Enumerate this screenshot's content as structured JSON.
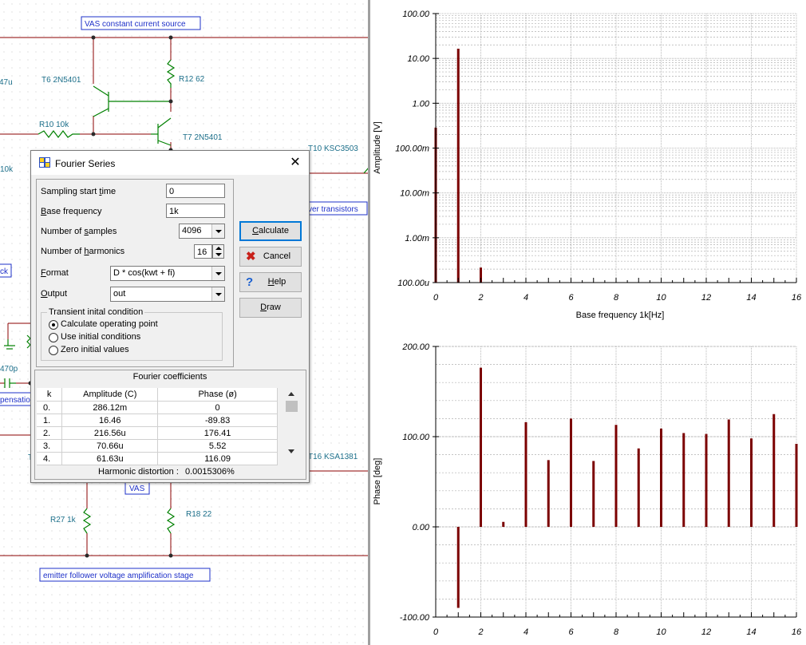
{
  "schematic": {
    "labels_boxed": [
      "VAS constant current source",
      "ver transistors",
      "ck",
      "pensatio",
      "VAS",
      "emitter follower voltage amplification stage"
    ],
    "labels": [
      "T6 2N5401",
      "R12 62",
      "R10 10k",
      "T7 2N5401",
      "T10 KSC3503",
      "47u",
      "10k",
      "470p",
      "T16 KSA1381",
      "R27 1k",
      "R18 22",
      "T"
    ]
  },
  "dialog": {
    "title": "Fourier Series",
    "close": "✕",
    "sampling_start_time": {
      "pre": "Sampling start ",
      "key": "t",
      "post": "ime",
      "value": "0"
    },
    "base_frequency": {
      "pre": "",
      "key": "B",
      "post": "ase frequency",
      "value": "1k"
    },
    "number_of_samples": {
      "pre": "Number of ",
      "key": "s",
      "post": "amples",
      "value": "4096"
    },
    "number_of_harmonics": {
      "pre": "Number of ",
      "key": "h",
      "post": "armonics",
      "value": "16"
    },
    "format": {
      "pre": "",
      "key": "F",
      "post": "ormat",
      "value": "D * cos(kwt + fi)"
    },
    "output": {
      "pre": "",
      "key": "O",
      "post": "utput",
      "value": "out"
    },
    "buttons": {
      "calculate": {
        "pre": "",
        "key": "C",
        "post": "alculate"
      },
      "cancel": "Cancel",
      "help": {
        "pre": "",
        "key": "H",
        "post": "elp"
      },
      "draw": {
        "pre": "",
        "key": "D",
        "post": "raw"
      }
    },
    "transient": {
      "title": "Transient inital condition",
      "options": [
        "Calculate operating point",
        "Use initial conditions",
        "Zero initial values"
      ],
      "selected": 0
    },
    "coefficients": {
      "title": "Fourier coefficients",
      "columns": [
        "k",
        "Amplitude (C)",
        "Phase (ø)"
      ],
      "rows": [
        [
          "0.",
          "286.12m",
          "0"
        ],
        [
          "1.",
          "16.46",
          "-89.83"
        ],
        [
          "2.",
          "216.56u",
          "176.41"
        ],
        [
          "3.",
          "70.66u",
          "5.52"
        ],
        [
          "4.",
          "61.63u",
          "116.09"
        ]
      ]
    },
    "distortion_label": "Harmonic distortion :",
    "distortion_value": "0.0015306%"
  },
  "chart_data": [
    {
      "type": "bar",
      "ylabel": "Amplitude [V]",
      "xlabel": "Base frequency 1k[Hz]",
      "yscale": "log",
      "ylim": [
        0.0001,
        100
      ],
      "ytick_labels": [
        "100.00",
        "10.00",
        "1.00",
        "100.00m",
        "10.00m",
        "1.00m",
        "100.00u"
      ],
      "xlim": [
        0,
        16
      ],
      "xtick_labels": [
        "0",
        "2",
        "4",
        "6",
        "8",
        "10",
        "12",
        "14",
        "16"
      ],
      "x": [
        0,
        1,
        2
      ],
      "values": [
        0.28612,
        16.46,
        0.00021656
      ],
      "color": "#7b0000",
      "grid": true
    },
    {
      "type": "bar",
      "ylabel": "Phase [deg]",
      "xlabel": "",
      "ylim": [
        -100,
        200
      ],
      "ytick_labels": [
        "200.00",
        "100.00",
        "0.00",
        "-100.00"
      ],
      "xlim": [
        0,
        16
      ],
      "xtick_labels": [
        "0",
        "2",
        "4",
        "6",
        "8",
        "10",
        "12",
        "14",
        "16"
      ],
      "x": [
        1,
        2,
        3,
        4,
        5,
        6,
        7,
        8,
        9,
        10,
        11,
        12,
        13,
        14,
        15,
        16
      ],
      "values": [
        -89.83,
        176.41,
        5.52,
        116.09,
        74,
        120,
        73,
        113,
        87,
        109,
        104,
        103,
        119,
        98,
        125,
        92
      ],
      "color": "#7b0000",
      "grid": true
    }
  ]
}
